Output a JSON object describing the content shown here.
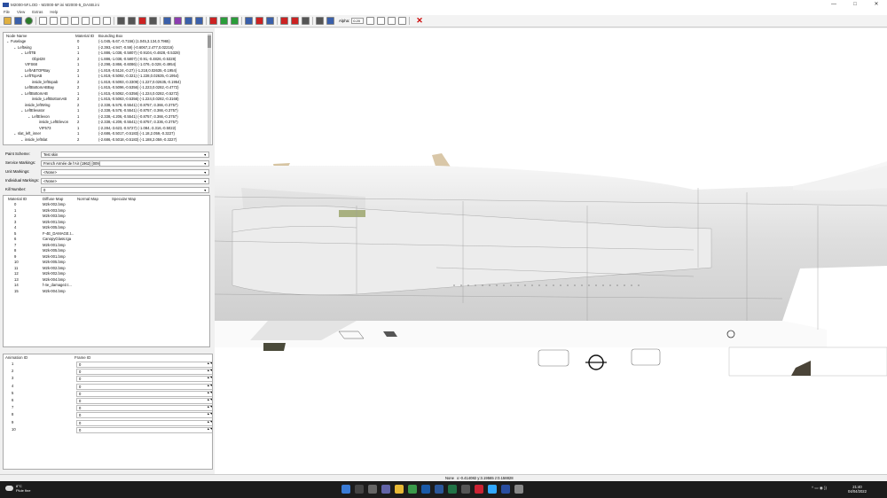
{
  "window": {
    "title": "M2000-5F.LOD - M2000-5F.ini M2000-5_DASB.ini",
    "controls": [
      "—",
      "□",
      "✕"
    ]
  },
  "menu": [
    "File",
    "View",
    "Extras",
    "Help"
  ],
  "toolbar": {
    "alpha_label": "Alpha:",
    "alpha_value": "0.20"
  },
  "tree": {
    "headers": {
      "name": "Node Name",
      "material": "Material ID",
      "bbox": "Bounding Box"
    },
    "rows": [
      {
        "name": "Fuselage",
        "indent": 0,
        "caret": "v",
        "mat": "0",
        "bbox": "(-1.045,-5.67,-0.7156) (1.045,3.134,0.7965)"
      },
      {
        "name": "Leftwing",
        "indent": 1,
        "caret": "v",
        "mat": "1",
        "bbox": "(-2.393,-4.947,-0.59) (-0.6067,2.477,0.02216)"
      },
      {
        "name": "LeftTB",
        "indent": 2,
        "caret": "v",
        "mat": "1",
        "bbox": "(-1.886,-1.038,-0.5807) (-0.9104,-0.4828,-0.5328)"
      },
      {
        "name": "Objet28",
        "indent": 3,
        "caret": "",
        "mat": "2",
        "bbox": "(-1.886,-1.038,-0.5807) (-0.91,-0.4826,-0.5328)"
      },
      {
        "name": "VIFS68",
        "indent": 2,
        "caret": "",
        "mat": "1",
        "bbox": "(-2.298,-3.866,-0.6086) (-1.076,-3.028,-0.4954)"
      },
      {
        "name": "LeftABTOPBay",
        "indent": 2,
        "caret": "",
        "mat": "2",
        "bbox": "(-1.819,-0.5124,-0.27) (-1.218,0.02635,-0.1954)"
      },
      {
        "name": "LeftTopAB",
        "indent": 2,
        "caret": "v",
        "mat": "1",
        "bbox": "(-1.819,-0.5092,-0.321) (-1.228,0.02635,-0.1954)"
      },
      {
        "name": "inside_lefttopab",
        "indent": 3,
        "caret": "",
        "mat": "2",
        "bbox": "(-1.819,-0.5093,-0.3309) (-1.227,0.02635,-0.1954)"
      },
      {
        "name": "LeftBottomABBay",
        "indent": 2,
        "caret": "",
        "mat": "2",
        "bbox": "(-1.815,-0.5096,-0.5356) (-1.223,0.0282,-0.4772)"
      },
      {
        "name": "LeftBottomAB",
        "indent": 2,
        "caret": "v",
        "mat": "1",
        "bbox": "(-1.815,-0.5062,-0.5356) (-1.224,0.0282,-0.5272)"
      },
      {
        "name": "inside_LeftBottomAB",
        "indent": 3,
        "caret": "",
        "mat": "2",
        "bbox": "(-1.815,-0.5063,-0.5356) (-1.224,0.0282,-0.3168)"
      },
      {
        "name": "inside_leftWing",
        "indent": 2,
        "caret": "",
        "mat": "2",
        "bbox": "(-2.338,-5.578,-0.5541) (-0.8757,-3.366,-0.3757)"
      },
      {
        "name": "LeftElevator",
        "indent": 2,
        "caret": "v",
        "mat": "1",
        "bbox": "(-2.338,-5.578,-0.5541) (-0.8757,-3.366,-0.3757)"
      },
      {
        "name": "LeftElevon",
        "indent": 3,
        "caret": "v",
        "mat": "1",
        "bbox": "(-2.338,-4.206,-0.5541) (-0.8757,-3.366,-0.3757)"
      },
      {
        "name": "inside_LeftElevon",
        "indent": 4,
        "caret": "",
        "mat": "2",
        "bbox": "(-2.338,-4.209,-0.5541) (-0.8757,-3.336,-0.3757)"
      },
      {
        "name": "VIF573",
        "indent": 4,
        "caret": "",
        "mat": "1",
        "bbox": "(-2.284,-3.623,-0.5727) (-1.084,-3.316,-0.5022)"
      },
      {
        "name": "slat_left_inner",
        "indent": 1,
        "caret": "v",
        "mat": "1",
        "bbox": "(-2.686,-0.5017,-0.5183) (-1.18,2.059,-0.3227)"
      },
      {
        "name": "inside_leftslat",
        "indent": 2,
        "caret": "v",
        "mat": "2",
        "bbox": "(-2.686,-0.5018,-0.5183) (-1.188,2.059,-0.3227)"
      }
    ]
  },
  "form": {
    "paint_scheme": {
      "label": "Paint Scheme:",
      "value": "Test skin"
    },
    "service_markings": {
      "label": "Service Markings:",
      "value": "French Armée de l'Air (1962) [009]"
    },
    "unit_markings": {
      "label": "Unit Markings:",
      "value": "<None>"
    },
    "individual_markings": {
      "label": "Individual Markings:",
      "value": "<None>"
    },
    "kill_number": {
      "label": "Kill Number:",
      "value": "0"
    }
  },
  "materials": {
    "headers": {
      "id": "Material ID",
      "diffuse": "Diffuse Map",
      "normal": "Normal Map",
      "specular": "Specular Map"
    },
    "rows": [
      {
        "id": "0",
        "diffuse": "M2k-002.bmp"
      },
      {
        "id": "1",
        "diffuse": "M2k-003.bmp"
      },
      {
        "id": "2",
        "diffuse": "M2k-003.bmp"
      },
      {
        "id": "3",
        "diffuse": "M2k-001.bmp"
      },
      {
        "id": "4",
        "diffuse": "M2k-005.bmp"
      },
      {
        "id": "5",
        "diffuse": "F-4E_DAMAGE.t..."
      },
      {
        "id": "6",
        "diffuse": "CanopyGlass.tga"
      },
      {
        "id": "7",
        "diffuse": "M2k-001.bmp"
      },
      {
        "id": "8",
        "diffuse": "M2k-005.bmp"
      },
      {
        "id": "9",
        "diffuse": "M2k-001.bmp"
      },
      {
        "id": "10",
        "diffuse": "M2k-005.bmp"
      },
      {
        "id": "11",
        "diffuse": "M2k-002.bmp"
      },
      {
        "id": "12",
        "diffuse": "M2k-002.bmp"
      },
      {
        "id": "13",
        "diffuse": "M2k-004.bmp"
      },
      {
        "id": "14",
        "diffuse": "f-4e_damage2.t..."
      },
      {
        "id": "15",
        "diffuse": "M2k-004.bmp"
      }
    ]
  },
  "animation": {
    "headers": {
      "id": "Animation ID",
      "frame": "Frame ID"
    },
    "rows": [
      {
        "id": "1",
        "frame": "0"
      },
      {
        "id": "2",
        "frame": "0"
      },
      {
        "id": "3",
        "frame": "0"
      },
      {
        "id": "4",
        "frame": "0"
      },
      {
        "id": "5",
        "frame": "0"
      },
      {
        "id": "6",
        "frame": "0"
      },
      {
        "id": "7",
        "frame": "0"
      },
      {
        "id": "8",
        "frame": "0"
      },
      {
        "id": "9",
        "frame": "0"
      },
      {
        "id": "10",
        "frame": "0"
      }
    ]
  },
  "status": {
    "mode": "None",
    "coords": "x:-0.414082 y:3.19565 z:0.158828"
  },
  "taskbar": {
    "temp": "8°C",
    "weather": "Pluie fine",
    "time": "21:40",
    "date": "04/04/2022"
  },
  "colors": {
    "taskbar": "#1c1c1c",
    "accent": "#2a4ea0"
  }
}
